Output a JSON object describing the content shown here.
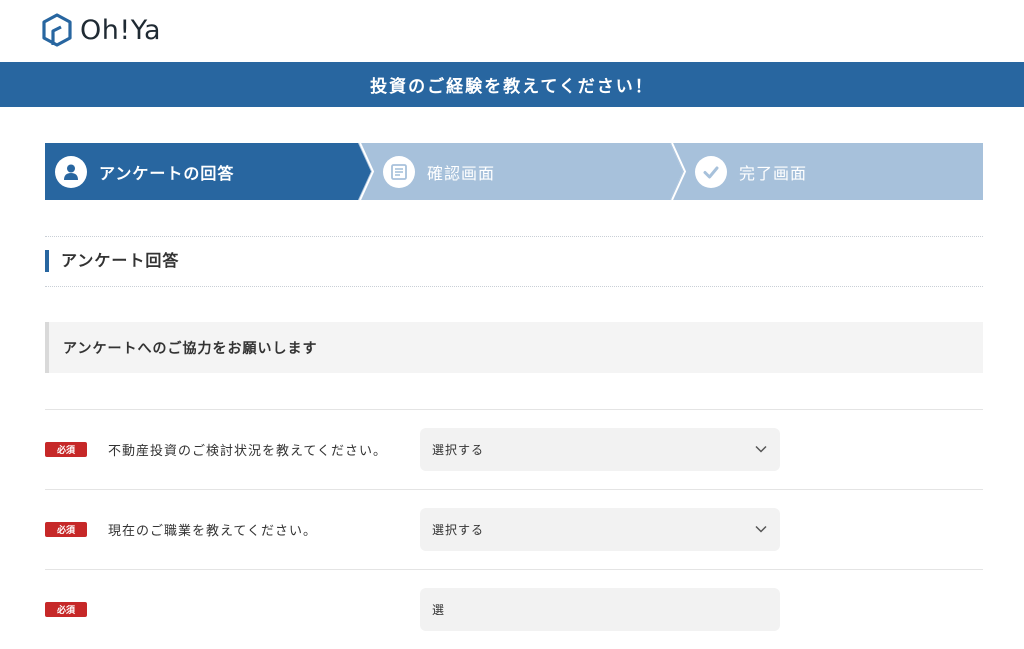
{
  "header": {
    "logo_text": "Oh!Ya"
  },
  "banner": {
    "title": "投資のご経験を教えてください！"
  },
  "steps": [
    {
      "label": "アンケートの回答",
      "state": "active",
      "icon": "person-icon"
    },
    {
      "label": "確認画面",
      "state": "inactive",
      "icon": "document-icon"
    },
    {
      "label": "完了画面",
      "state": "inactive",
      "icon": "check-icon"
    }
  ],
  "section": {
    "title": "アンケート回答"
  },
  "notice": {
    "text": "アンケートへのご協力をお願いします"
  },
  "questions": [
    {
      "badge": "必須",
      "text": "不動産投資のご検討状況を教えてください。",
      "select_value": "選択する"
    },
    {
      "badge": "必須",
      "text": "現在のご職業を教えてください。",
      "select_value": "選択する"
    },
    {
      "badge": "必須",
      "text": "",
      "select_value": "選"
    }
  ],
  "colors": {
    "brand_blue": "#2866a0",
    "step_inactive": "#a7c1db",
    "required_red": "#c62828"
  }
}
